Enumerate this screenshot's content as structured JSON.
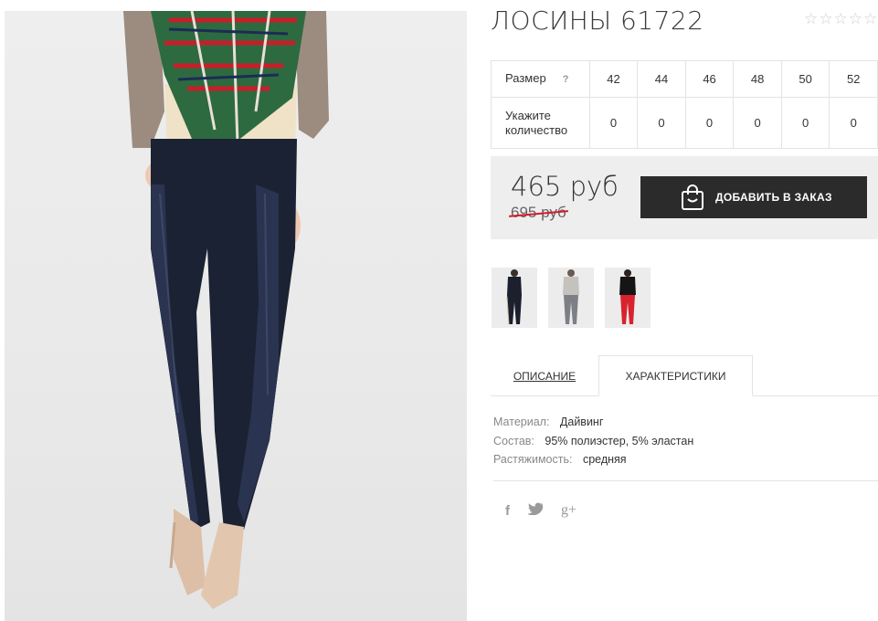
{
  "product": {
    "title": "ЛОСИНЫ 61722",
    "rating_stars": 5,
    "rating_value": 0
  },
  "size_table": {
    "size_label": "Размер",
    "help_label": "?",
    "sizes": [
      "42",
      "44",
      "46",
      "48",
      "50",
      "52"
    ],
    "quantity_label": "Укажите количество",
    "quantities": [
      "0",
      "0",
      "0",
      "0",
      "0",
      "0"
    ]
  },
  "price": {
    "current": "465 руб",
    "old": "695 руб",
    "strike_color": "#d11d2b"
  },
  "buttons": {
    "add_to_order": "ДОБАВИТЬ В ЗАКАЗ",
    "add_icon": "shopping-bag-icon"
  },
  "thumbnails": [
    {
      "variant": "black",
      "color": "#1b1f2e"
    },
    {
      "variant": "grey",
      "color": "#7d7f86"
    },
    {
      "variant": "red",
      "color": "#d8232f"
    }
  ],
  "tabs": {
    "description": "ОПИСАНИЕ",
    "characteristics": "ХАРАКТЕРИСТИКИ",
    "active": "characteristics"
  },
  "characteristics": [
    {
      "key": "Материал:",
      "value": "Дайвинг"
    },
    {
      "key": "Состав:",
      "value": "95% полиэстер, 5% эластан"
    },
    {
      "key": "Растяжимость:",
      "value": "средняя"
    }
  ],
  "social": {
    "facebook": "f",
    "twitter": "twitter-icon",
    "googleplus": "g+"
  },
  "colors": {
    "button_bg": "#2b2b2b",
    "price_box_bg": "#eeeeee",
    "product_navy": "#1b2233"
  }
}
